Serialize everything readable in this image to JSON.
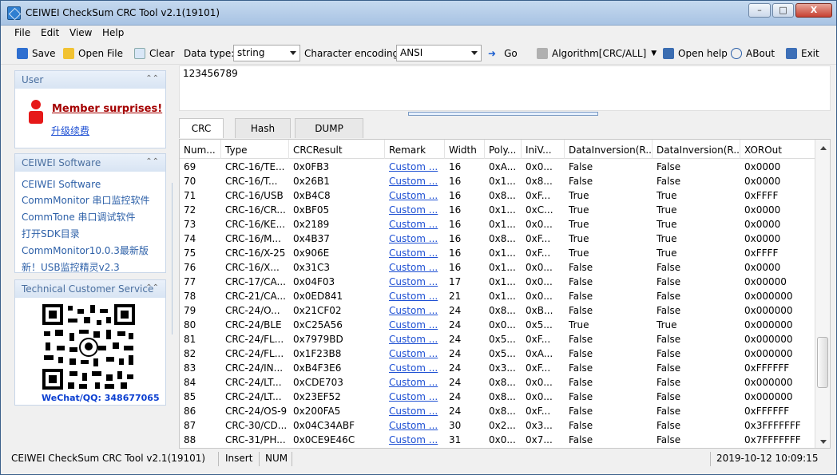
{
  "window": {
    "title": "CEIWEI CheckSum CRC Tool v2.1(19101)",
    "buttons": {
      "min": "–",
      "max": "□",
      "close": "X"
    }
  },
  "menu": {
    "items": [
      "File",
      "Edit",
      "View",
      "Help"
    ]
  },
  "toolbar": {
    "save": "Save",
    "open_file": "Open File",
    "clear": "Clear",
    "data_type_label": "Data type:",
    "data_type_value": "string",
    "char_enc_label": "Character encoding:",
    "char_enc_value": "ANSI",
    "go": "Go",
    "algorithm": "Algorithm[CRC/ALL]",
    "open_help": "Open help",
    "about": "ABout",
    "exit": "Exit"
  },
  "sidebar": {
    "user": {
      "title": "User",
      "member_text": "Member surprises!",
      "upgrade_link": "升级续费"
    },
    "software": {
      "title": "CEIWEI Software",
      "links": [
        "CEIWEI Software",
        "CommMonitor 串口监控软件",
        "CommTone 串口调试软件",
        "打开SDK目录",
        "CommMonitor10.0.3最新版",
        "新！USB监控精灵v2.3"
      ]
    },
    "service": {
      "title": "Technical Customer Service",
      "wechat": "WeChat/QQ: 348677065"
    }
  },
  "input": {
    "text": "123456789"
  },
  "tabs": [
    "CRC",
    "Hash",
    "DUMP"
  ],
  "table": {
    "headers": [
      "Num...",
      "Type",
      "CRCResult",
      "Remark",
      "Width",
      "Poly...",
      "IniV...",
      "DataInversion(R...",
      "DataInversion(R...",
      "XOROut"
    ],
    "rows": [
      [
        "69",
        "CRC-16/TE...",
        "0x0FB3",
        "Custom ...",
        "16",
        "0xA...",
        "0x0...",
        "False",
        "False",
        "0x0000"
      ],
      [
        "70",
        "CRC-16/T...",
        "0x26B1",
        "Custom ...",
        "16",
        "0x1...",
        "0x8...",
        "False",
        "False",
        "0x0000"
      ],
      [
        "71",
        "CRC-16/USB",
        "0xB4C8",
        "Custom ...",
        "16",
        "0x8...",
        "0xF...",
        "True",
        "True",
        "0xFFFF"
      ],
      [
        "72",
        "CRC-16/CR...",
        "0xBF05",
        "Custom ...",
        "16",
        "0x1...",
        "0xC...",
        "True",
        "True",
        "0x0000"
      ],
      [
        "73",
        "CRC-16/KE...",
        "0x2189",
        "Custom ...",
        "16",
        "0x1...",
        "0x0...",
        "True",
        "True",
        "0x0000"
      ],
      [
        "74",
        "CRC-16/M...",
        "0x4B37",
        "Custom ...",
        "16",
        "0x8...",
        "0xF...",
        "True",
        "True",
        "0x0000"
      ],
      [
        "75",
        "CRC-16/X-25",
        "0x906E",
        "Custom ...",
        "16",
        "0x1...",
        "0xF...",
        "True",
        "True",
        "0xFFFF"
      ],
      [
        "76",
        "CRC-16/X...",
        "0x31C3",
        "Custom ...",
        "16",
        "0x1...",
        "0x0...",
        "False",
        "False",
        "0x0000"
      ],
      [
        "77",
        "CRC-17/CA...",
        "0x04F03",
        "Custom ...",
        "17",
        "0x1...",
        "0x0...",
        "False",
        "False",
        "0x00000"
      ],
      [
        "78",
        "CRC-21/CA...",
        "0x0ED841",
        "Custom ...",
        "21",
        "0x1...",
        "0x0...",
        "False",
        "False",
        "0x000000"
      ],
      [
        "79",
        "CRC-24/O...",
        "0x21CF02",
        "Custom ...",
        "24",
        "0x8...",
        "0xB...",
        "False",
        "False",
        "0x000000"
      ],
      [
        "80",
        "CRC-24/BLE",
        "0xC25A56",
        "Custom ...",
        "24",
        "0x0...",
        "0x5...",
        "True",
        "True",
        "0x000000"
      ],
      [
        "81",
        "CRC-24/FL...",
        "0x7979BD",
        "Custom ...",
        "24",
        "0x5...",
        "0xF...",
        "False",
        "False",
        "0x000000"
      ],
      [
        "82",
        "CRC-24/FL...",
        "0x1F23B8",
        "Custom ...",
        "24",
        "0x5...",
        "0xA...",
        "False",
        "False",
        "0x000000"
      ],
      [
        "83",
        "CRC-24/IN...",
        "0xB4F3E6",
        "Custom ...",
        "24",
        "0x3...",
        "0xF...",
        "False",
        "False",
        "0xFFFFFF"
      ],
      [
        "84",
        "CRC-24/LT...",
        "0xCDE703",
        "Custom ...",
        "24",
        "0x8...",
        "0x0...",
        "False",
        "False",
        "0x000000"
      ],
      [
        "85",
        "CRC-24/LT...",
        "0x23EF52",
        "Custom ...",
        "24",
        "0x8...",
        "0x0...",
        "False",
        "False",
        "0x000000"
      ],
      [
        "86",
        "CRC-24/OS-9",
        "0x200FA5",
        "Custom ...",
        "24",
        "0x8...",
        "0xF...",
        "False",
        "False",
        "0xFFFFFF"
      ],
      [
        "87",
        "CRC-30/CD...",
        "0x04C34ABF",
        "Custom ...",
        "30",
        "0x2...",
        "0x3...",
        "False",
        "False",
        "0x3FFFFFFF"
      ],
      [
        "88",
        "CRC-31/PH...",
        "0x0CE9E46C",
        "Custom ...",
        "31",
        "0x0...",
        "0x7...",
        "False",
        "False",
        "0x7FFFFFFF"
      ]
    ]
  },
  "status": {
    "app": "CEIWEI CheckSum CRC Tool v2.1(19101)",
    "insert": "Insert",
    "num": "NUM",
    "datetime": "2019-10-12 10:09:15"
  },
  "colors": {
    "title_bar": "#b7cfe9",
    "sidebar_head": "#4b70a0",
    "link": "#1d4fd3",
    "member_red": "#c00000"
  }
}
